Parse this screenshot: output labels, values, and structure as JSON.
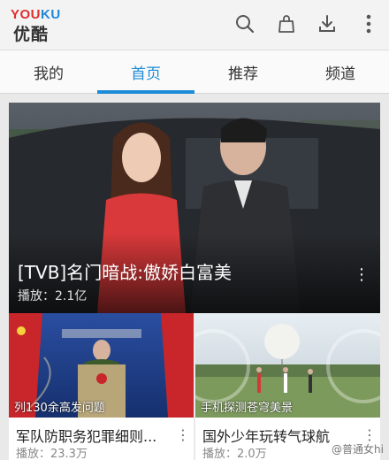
{
  "header": {
    "logo_en_part1": "YOU",
    "logo_en_part2": "KU",
    "logo_cn": "优酷",
    "icons": [
      "search-icon",
      "shopping-bag-icon",
      "download-icon",
      "more-vertical-icon"
    ]
  },
  "tabs": [
    {
      "label": "我的",
      "active": false
    },
    {
      "label": "首页",
      "active": true
    },
    {
      "label": "推荐",
      "active": false
    },
    {
      "label": "频道",
      "active": false
    }
  ],
  "featured": {
    "title": "[TVB]名门暗战:傲娇白富美",
    "plays": "播放：2.1亿"
  },
  "cards": [
    {
      "thumb_caption": "列130余高发问题",
      "title": "军队防职务犯罪细则...",
      "plays": "播放：23.3万"
    },
    {
      "thumb_caption": "手机探测苍穹美景",
      "title": "国外少年玩转气球航",
      "plays": "播放：2.0万"
    }
  ],
  "watermark": "@普通女hi",
  "colors": {
    "accent": "#1e8bd6",
    "logo_red": "#e02d2d",
    "logo_blue": "#1e88d8"
  }
}
